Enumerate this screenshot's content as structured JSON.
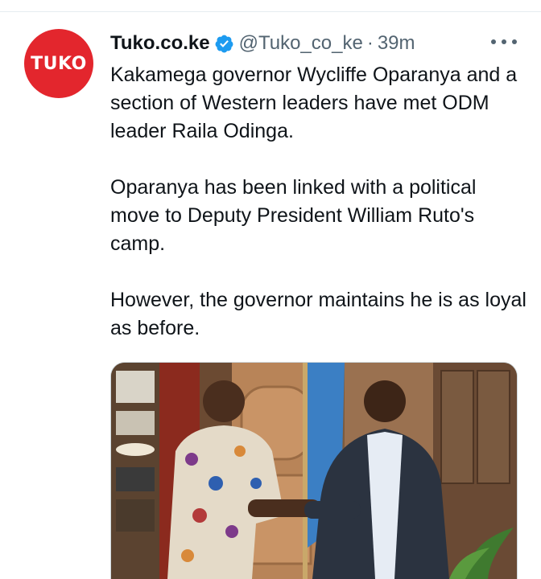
{
  "account": {
    "avatar_text": "TUKO",
    "display_name": "Tuko.co.ke",
    "handle": "@Tuko_co_ke",
    "separator": "·",
    "time": "39m",
    "verified": true
  },
  "tweet": {
    "paragraphs": [
      "Kakamega governor Wycliffe Oparanya and a section of Western leaders have met ODM leader Raila Odinga.",
      "Oparanya has been linked with a political move to Deputy President William Ruto's camp.",
      "However, the governor maintains he is as loyal as before."
    ]
  },
  "icons": {
    "verified": "verified-badge-icon",
    "more": "more-options-icon"
  },
  "colors": {
    "brand_red": "#e3262d",
    "verified_blue": "#1d9bf0",
    "text_primary": "#0f1419",
    "text_secondary": "#536471"
  }
}
